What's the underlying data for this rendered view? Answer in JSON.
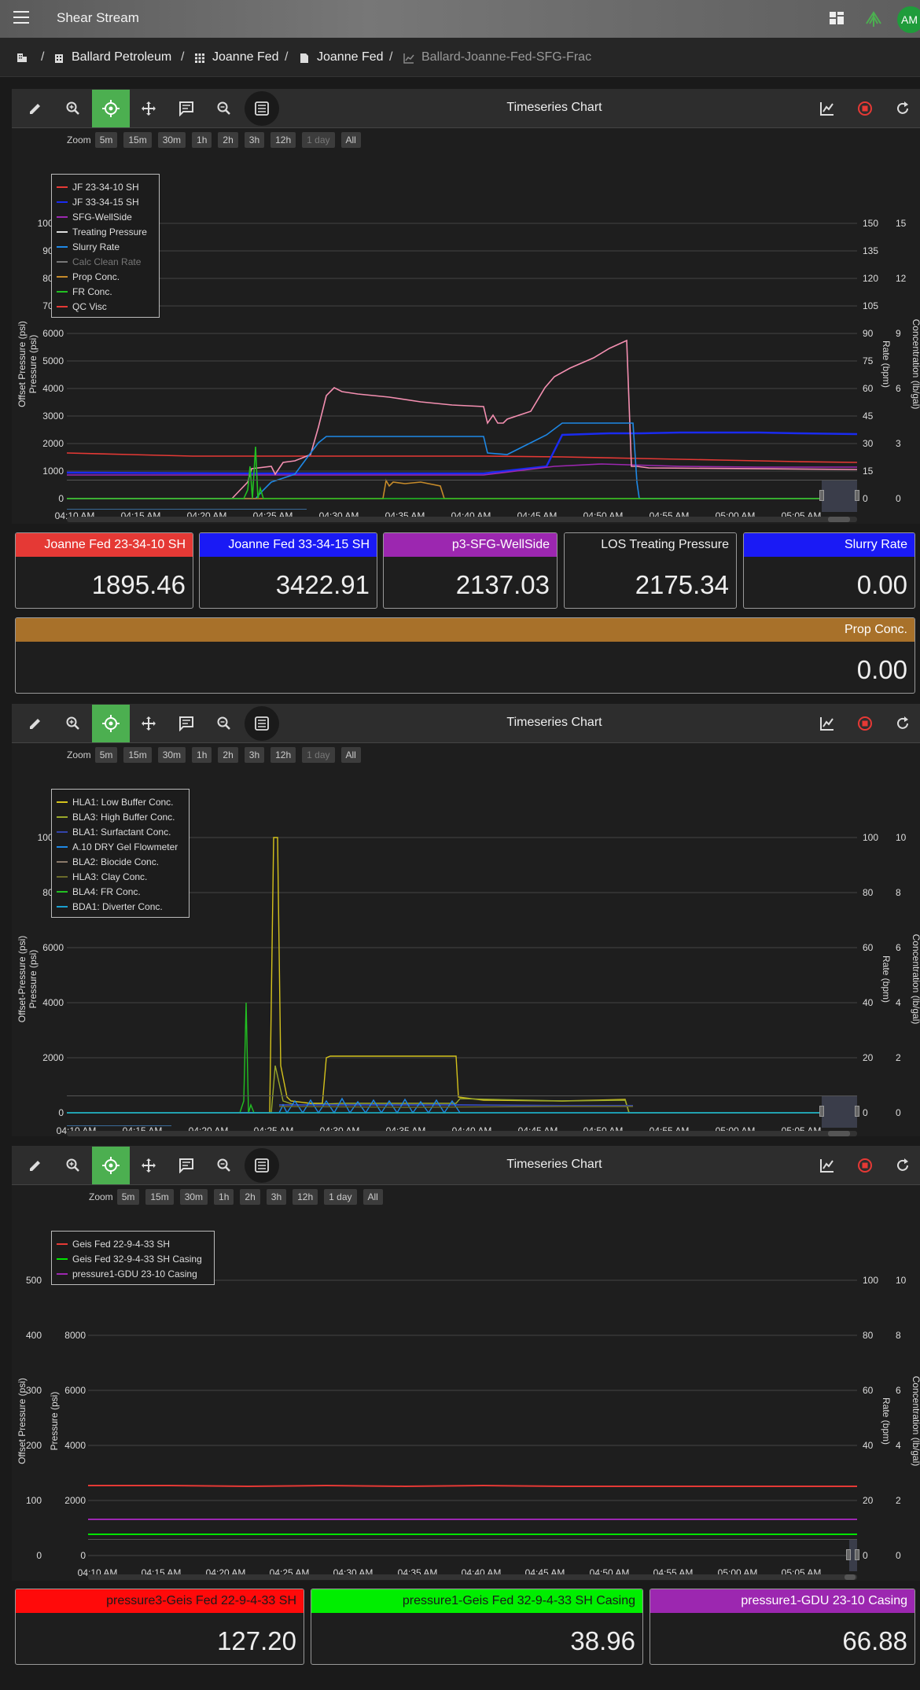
{
  "app": {
    "title": "Shear Stream",
    "avatar": "AM",
    "menu_icon": "menu-icon",
    "dashboard_icon": "dashboard-icon",
    "logo_icon": "leaf-logo-icon"
  },
  "breadcrumb": {
    "root_icon": "building-icon",
    "items": [
      {
        "label": "Ballard Petroleum",
        "icon": "building-icon"
      },
      {
        "label": "Joanne Fed",
        "icon": "grid-icon"
      },
      {
        "label": "Joanne Fed",
        "icon": "well-icon"
      },
      {
        "label": "Ballard-Joanne-Fed-SFG-Frac",
        "icon": "chart-icon"
      }
    ],
    "separator": "/"
  },
  "toolbar": {
    "title": "Timeseries Chart",
    "buttons": [
      "edit-icon",
      "zoom-in-icon",
      "crosshair-icon",
      "pan-icon",
      "comment-icon",
      "zoom-out-icon",
      "list-icon"
    ],
    "right_buttons": [
      "chart-icon",
      "stop-icon",
      "refresh-icon"
    ]
  },
  "zoom": {
    "label": "Zoom",
    "options": [
      "5m",
      "15m",
      "30m",
      "1h",
      "2h",
      "3h",
      "12h",
      "1 day",
      "All"
    ]
  },
  "colors": {
    "red": "#e53935",
    "blue": "#1a2bf0",
    "purple": "#9c27b0",
    "pink": "#f48fb1",
    "cyan": "#1e88e5",
    "green": "#22c022",
    "orange": "#c58a2a",
    "yellow": "#d4c21c",
    "lime": "#00e400",
    "prop": "#b07a2a"
  },
  "chart1": {
    "x_ticks": [
      "04:10 AM",
      "04:15 AM",
      "04:20 AM",
      "04:25 AM",
      "04:30 AM",
      "04:35 AM",
      "04:40 AM",
      "04:45 AM",
      "04:50 AM",
      "04:55 AM",
      "05:00 AM",
      "05:05 AM"
    ],
    "y_left": [
      "10000",
      "9000",
      "8000",
      "7000",
      "6000",
      "5000",
      "4000",
      "3000",
      "2000",
      "1000",
      "0"
    ],
    "y_rate": [
      "150",
      "135",
      "120",
      "105",
      "90",
      "75",
      "60",
      "45",
      "30",
      "15",
      "0"
    ],
    "y_conc": [
      "15",
      "12",
      "9",
      "6",
      "3",
      "0"
    ],
    "ylabel_offset": "Offset Pressure (psi)",
    "ylabel_pressure": "Pressure (psi)",
    "ylabel_rate": "Rate (bpm)",
    "ylabel_conc": "Concentration (lb/gal)",
    "legend": [
      {
        "label": "JF 23-34-10 SH",
        "color": "#e53935"
      },
      {
        "label": "JF 33-34-15 SH",
        "color": "#1a2bf0"
      },
      {
        "label": "SFG-WellSide",
        "color": "#9c27b0"
      },
      {
        "label": "Treating Pressure",
        "color": "#dddddd"
      },
      {
        "label": "Slurry Rate",
        "color": "#1e88e5"
      },
      {
        "label": "Calc Clean Rate",
        "color": "#777777",
        "dim": true
      },
      {
        "label": "Prop Conc.",
        "color": "#c58a2a"
      },
      {
        "label": "FR Conc.",
        "color": "#22c022"
      },
      {
        "label": "QC Visc",
        "color": "#e53935"
      }
    ]
  },
  "cards1": [
    {
      "label": "Joanne Fed 23-34-10 SH",
      "value": "1895.46",
      "bg": "#e53935",
      "fg": "#ffffff"
    },
    {
      "label": "Joanne Fed 33-34-15 SH",
      "value": "3422.91",
      "bg": "#1a1af5",
      "fg": "#ffffff"
    },
    {
      "label": "p3-SFG-WellSide",
      "value": "2137.03",
      "bg": "#9c27b0",
      "fg": "#ffffff"
    },
    {
      "label": "LOS Treating Pressure",
      "value": "2175.34",
      "bg": "#1e1e1e",
      "fg": "#eeeeee"
    },
    {
      "label": "Slurry Rate",
      "value": "0.00",
      "bg": "#1a1af5",
      "fg": "#ffffff"
    }
  ],
  "card_prop": {
    "label": "Prop Conc.",
    "value": "0.00",
    "bg": "#a8712a",
    "fg": "#ffffff"
  },
  "chart2": {
    "x_ticks": [
      "04:10 AM",
      "04:15 AM",
      "04:20 AM",
      "04:25 AM",
      "04:30 AM",
      "04:35 AM",
      "04:40 AM",
      "04:45 AM",
      "04:50 AM",
      "04:55 AM",
      "05:00 AM",
      "05:05 AM"
    ],
    "y_left": [
      "10000",
      "8000",
      "6000",
      "4000",
      "2000",
      "0"
    ],
    "y_rate": [
      "100",
      "80",
      "60",
      "40",
      "20",
      "0"
    ],
    "y_conc": [
      "10",
      "8",
      "6",
      "4",
      "2",
      "0"
    ],
    "ylabel_offset": "Offset-Pressure (psi)",
    "ylabel_pressure": "Pressure (psi)",
    "ylabel_rate": "Rate (bpm)",
    "ylabel_conc": "Concentration (lb/gal)",
    "legend": [
      {
        "label": "HLA1: Low Buffer Conc.",
        "color": "#d4c21c"
      },
      {
        "label": "BLA3: High Buffer Conc.",
        "color": "#9aa82a"
      },
      {
        "label": "BLA1: Surfactant Conc.",
        "color": "#3344aa"
      },
      {
        "label": "A.10 DRY Gel Flowmeter",
        "color": "#1e88e5"
      },
      {
        "label": "BLA2: Biocide Conc.",
        "color": "#8a7a6a"
      },
      {
        "label": "HLA3: Clay Conc.",
        "color": "#6a6a2a"
      },
      {
        "label": "BLA4: FR Conc.",
        "color": "#22c022"
      },
      {
        "label": "BDA1: Diverter Conc.",
        "color": "#1aa0d0"
      }
    ]
  },
  "chart3": {
    "x_ticks": [
      "04:10 AM",
      "04:15 AM",
      "04:20 AM",
      "04:25 AM",
      "04:30 AM",
      "04:35 AM",
      "04:40 AM",
      "04:45 AM",
      "04:50 AM",
      "04:55 AM",
      "05:00 AM",
      "05:05 AM"
    ],
    "y_offset": [
      "500",
      "400",
      "300",
      "200",
      "100",
      "0"
    ],
    "y_left": [
      "10000",
      "8000",
      "6000",
      "4000",
      "2000",
      "0"
    ],
    "y_rate": [
      "100",
      "80",
      "60",
      "40",
      "20",
      "0"
    ],
    "y_conc": [
      "10",
      "8",
      "6",
      "4",
      "2",
      "0"
    ],
    "ylabel_offset": "Offset Pressure (psi)",
    "ylabel_pressure": "Pressure (psi)",
    "ylabel_rate": "Rate (bpm)",
    "ylabel_conc": "Concentration (lb/gal)",
    "legend": [
      {
        "label": "Geis Fed 22-9-4-33 SH",
        "color": "#e53935"
      },
      {
        "label": "Geis Fed 32-9-4-33 SH Casing",
        "color": "#00e400"
      },
      {
        "label": "pressure1-GDU 23-10 Casing",
        "color": "#9c27b0"
      }
    ]
  },
  "cards3": [
    {
      "label": "pressure3-Geis Fed 22-9-4-33 SH",
      "value": "127.20",
      "bg": "#ff0a0a",
      "fg": "#1a1a1a"
    },
    {
      "label": "pressure1-Geis Fed 32-9-4-33 SH Casing",
      "value": "38.96",
      "bg": "#00ee00",
      "fg": "#1a1a1a"
    },
    {
      "label": "pressure1-GDU 23-10 Casing",
      "value": "66.88",
      "bg": "#9c27b0",
      "fg": "#ffffff"
    }
  ]
}
